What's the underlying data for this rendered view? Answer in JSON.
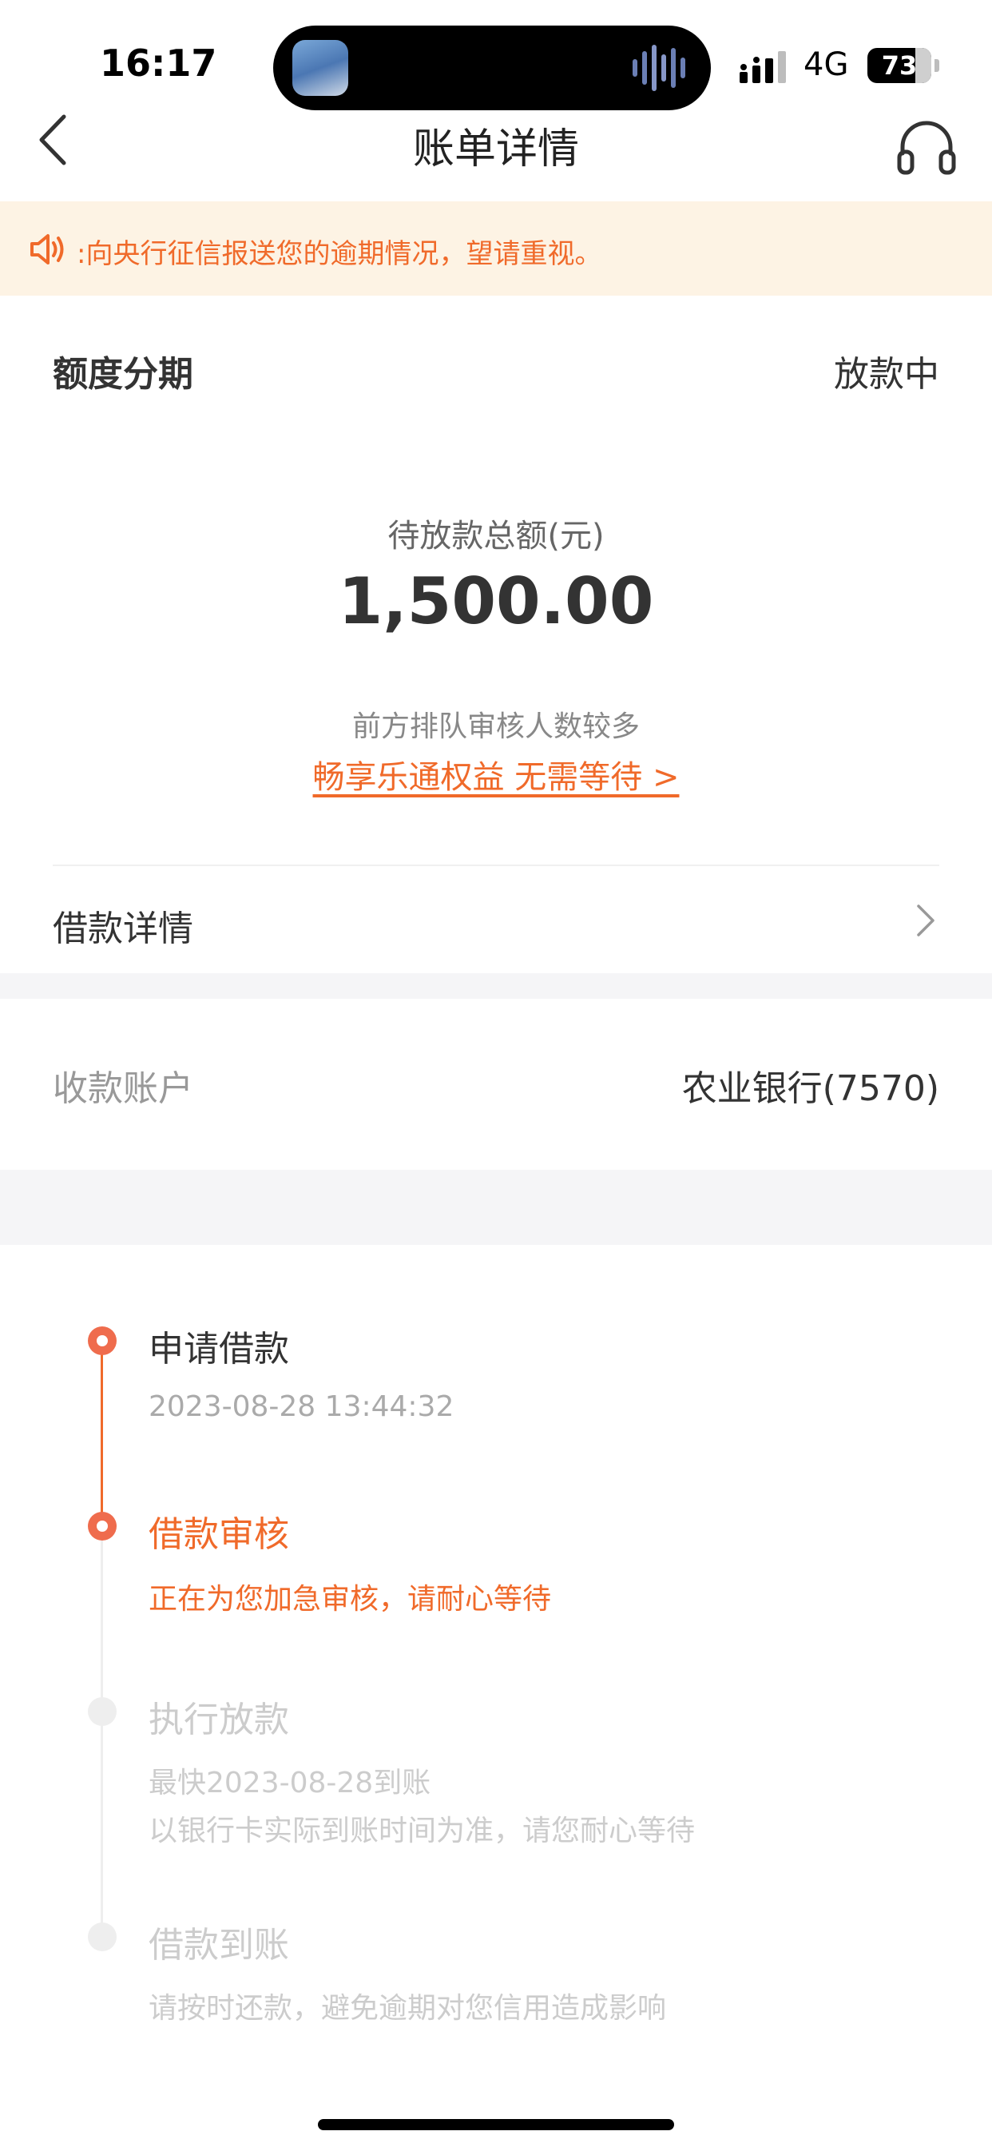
{
  "status_bar": {
    "time": "16:17",
    "network": "4G",
    "battery": "73"
  },
  "nav": {
    "title": "账单详情",
    "back_icon": "chevron-left-icon",
    "service_icon": "headset-icon"
  },
  "notice": {
    "icon": "speaker-icon",
    "text": ":向央行征信报送您的逾期情况，望请重视。"
  },
  "card": {
    "product": "额度分期",
    "status": "放款中",
    "amount_label": "待放款总额(元)",
    "amount": "1,500.00",
    "queue_text": "前方排队审核人数较多",
    "vip_link": "畅享乐通权益 无需等待 >",
    "loan_detail_label": "借款详情"
  },
  "account": {
    "label": "收款账户",
    "value": "农业银行(7570)"
  },
  "timeline": [
    {
      "title": "申请借款",
      "lines": [
        "2023-08-28 13:44:32"
      ],
      "state": "done"
    },
    {
      "title": "借款审核",
      "lines": [
        "正在为您加急审核，请耐心等待"
      ],
      "state": "current"
    },
    {
      "title": "执行放款",
      "lines": [
        "最快2023-08-28到账",
        "以银行卡实际到账时间为准，请您耐心等待"
      ],
      "state": "pending"
    },
    {
      "title": "借款到账",
      "lines": [
        "请按时还款，避免逾期对您信用造成影响"
      ],
      "state": "pending"
    }
  ],
  "colors": {
    "accent": "#f06a2a",
    "notice_bg": "#fdf3e4",
    "section_gap": "#f5f5f7"
  }
}
